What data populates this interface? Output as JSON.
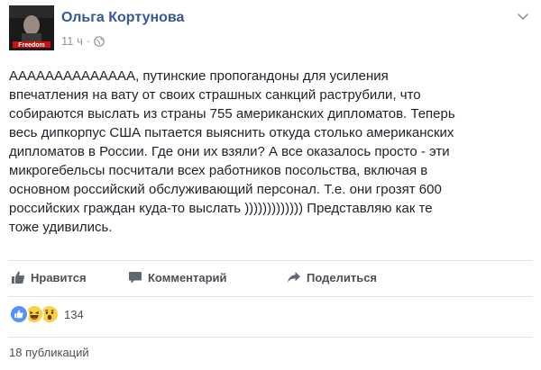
{
  "post": {
    "author": "Ольга Кортунова",
    "time": "11 ч",
    "time_separator": "·",
    "privacy_icon": "globe-icon",
    "menu_icon": "chevron-down-icon",
    "avatar_caption": "Freedom",
    "text_lines": [
      "АААААААААААААА, путинские пропогандоны для усиления",
      "впечатления на вату от своих страшных санкций раструбили, что",
      "собираются выслать из страны 755 американских дипломатов. Теперь",
      "весь дипкорпус США пытается выяснить откуда столько американских",
      "дипломатов в России. Где они их взяли? А все оказалось просто - эти",
      "микрогебельсы посчитали всех работников посольства, включая в",
      "основном российский обслуживающий персонал. Т.е. они грозят 600",
      "российских граждан куда-то выслать ))))))))))))) Представляю как те",
      "тоже удивились."
    ]
  },
  "actions": {
    "like_label": "Нравится",
    "comment_label": "Комментарий",
    "share_label": "Поделиться"
  },
  "reactions": {
    "icons": [
      "like-reaction-icon",
      "haha-reaction-icon",
      "wow-reaction-icon"
    ],
    "count": "134"
  },
  "footer": {
    "shares": "18 публикаций"
  },
  "colors": {
    "author_link": "#365899",
    "meta_gray": "#90949c",
    "action_gray": "#4b4f56",
    "like_blue": "#5890ff",
    "emoji_yellow": "#fcd13f"
  }
}
